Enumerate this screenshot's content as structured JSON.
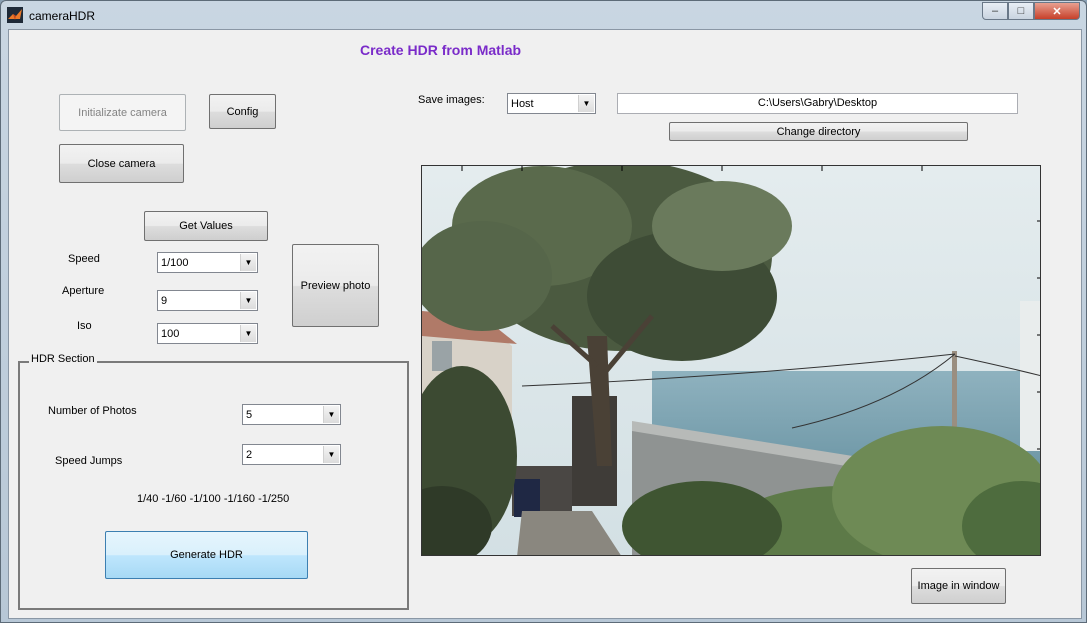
{
  "window": {
    "title": "cameraHDR",
    "controls": {
      "minimize": "–",
      "maximize": "□",
      "close": "✕"
    }
  },
  "heading": "Create HDR from Matlab",
  "camera": {
    "init_label": "Initializate camera",
    "config_label": "Config",
    "close_label": "Close camera",
    "get_values_label": "Get Values",
    "preview_label": "Preview photo"
  },
  "settings": {
    "speed_label": "Speed",
    "speed_value": "1/100",
    "aperture_label": "Aperture",
    "aperture_value": "9",
    "iso_label": "Iso",
    "iso_value": "100"
  },
  "save": {
    "label": "Save images:",
    "target_value": "Host",
    "directory": "C:\\Users\\Gabry\\Desktop",
    "change_label": "Change directory"
  },
  "hdr": {
    "title": "HDR Section",
    "num_photos_label": "Number of Photos",
    "num_photos_value": "5",
    "speed_jumps_label": "Speed Jumps",
    "speed_jumps_value": "2",
    "speeds_text": "1/40 -1/60 -1/100 -1/160 -1/250",
    "generate_label": "Generate HDR"
  },
  "image_window_label": "Image in window",
  "colors": {
    "heading": "#7a2bc9",
    "primary_button": "#a7d9f5"
  },
  "icons": {
    "app": "matlab-logo-icon",
    "dropdown": "chevron-down-icon"
  }
}
